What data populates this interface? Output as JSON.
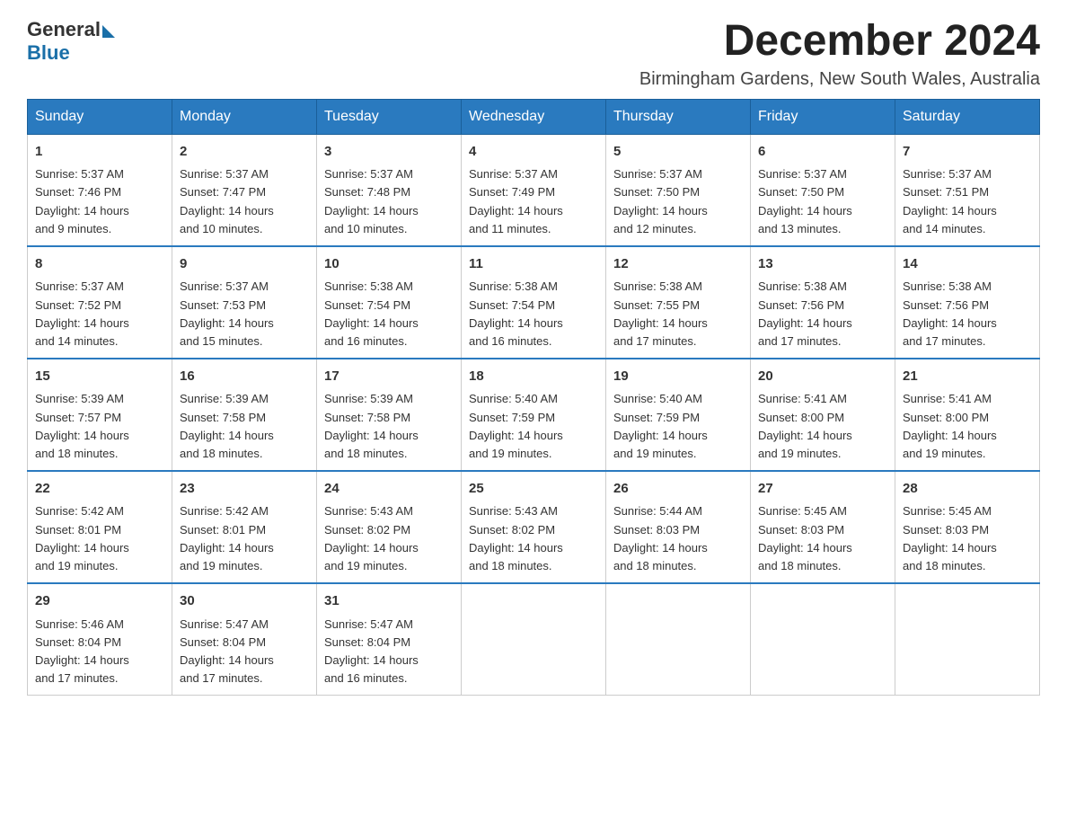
{
  "logo": {
    "general": "General",
    "blue": "Blue"
  },
  "title": {
    "month_year": "December 2024",
    "location": "Birmingham Gardens, New South Wales, Australia"
  },
  "days_header": [
    "Sunday",
    "Monday",
    "Tuesday",
    "Wednesday",
    "Thursday",
    "Friday",
    "Saturday"
  ],
  "weeks": [
    [
      {
        "day": "1",
        "sunrise": "5:37 AM",
        "sunset": "7:46 PM",
        "daylight": "14 hours and 9 minutes."
      },
      {
        "day": "2",
        "sunrise": "5:37 AM",
        "sunset": "7:47 PM",
        "daylight": "14 hours and 10 minutes."
      },
      {
        "day": "3",
        "sunrise": "5:37 AM",
        "sunset": "7:48 PM",
        "daylight": "14 hours and 10 minutes."
      },
      {
        "day": "4",
        "sunrise": "5:37 AM",
        "sunset": "7:49 PM",
        "daylight": "14 hours and 11 minutes."
      },
      {
        "day": "5",
        "sunrise": "5:37 AM",
        "sunset": "7:50 PM",
        "daylight": "14 hours and 12 minutes."
      },
      {
        "day": "6",
        "sunrise": "5:37 AM",
        "sunset": "7:50 PM",
        "daylight": "14 hours and 13 minutes."
      },
      {
        "day": "7",
        "sunrise": "5:37 AM",
        "sunset": "7:51 PM",
        "daylight": "14 hours and 14 minutes."
      }
    ],
    [
      {
        "day": "8",
        "sunrise": "5:37 AM",
        "sunset": "7:52 PM",
        "daylight": "14 hours and 14 minutes."
      },
      {
        "day": "9",
        "sunrise": "5:37 AM",
        "sunset": "7:53 PM",
        "daylight": "14 hours and 15 minutes."
      },
      {
        "day": "10",
        "sunrise": "5:38 AM",
        "sunset": "7:54 PM",
        "daylight": "14 hours and 16 minutes."
      },
      {
        "day": "11",
        "sunrise": "5:38 AM",
        "sunset": "7:54 PM",
        "daylight": "14 hours and 16 minutes."
      },
      {
        "day": "12",
        "sunrise": "5:38 AM",
        "sunset": "7:55 PM",
        "daylight": "14 hours and 17 minutes."
      },
      {
        "day": "13",
        "sunrise": "5:38 AM",
        "sunset": "7:56 PM",
        "daylight": "14 hours and 17 minutes."
      },
      {
        "day": "14",
        "sunrise": "5:38 AM",
        "sunset": "7:56 PM",
        "daylight": "14 hours and 17 minutes."
      }
    ],
    [
      {
        "day": "15",
        "sunrise": "5:39 AM",
        "sunset": "7:57 PM",
        "daylight": "14 hours and 18 minutes."
      },
      {
        "day": "16",
        "sunrise": "5:39 AM",
        "sunset": "7:58 PM",
        "daylight": "14 hours and 18 minutes."
      },
      {
        "day": "17",
        "sunrise": "5:39 AM",
        "sunset": "7:58 PM",
        "daylight": "14 hours and 18 minutes."
      },
      {
        "day": "18",
        "sunrise": "5:40 AM",
        "sunset": "7:59 PM",
        "daylight": "14 hours and 19 minutes."
      },
      {
        "day": "19",
        "sunrise": "5:40 AM",
        "sunset": "7:59 PM",
        "daylight": "14 hours and 19 minutes."
      },
      {
        "day": "20",
        "sunrise": "5:41 AM",
        "sunset": "8:00 PM",
        "daylight": "14 hours and 19 minutes."
      },
      {
        "day": "21",
        "sunrise": "5:41 AM",
        "sunset": "8:00 PM",
        "daylight": "14 hours and 19 minutes."
      }
    ],
    [
      {
        "day": "22",
        "sunrise": "5:42 AM",
        "sunset": "8:01 PM",
        "daylight": "14 hours and 19 minutes."
      },
      {
        "day": "23",
        "sunrise": "5:42 AM",
        "sunset": "8:01 PM",
        "daylight": "14 hours and 19 minutes."
      },
      {
        "day": "24",
        "sunrise": "5:43 AM",
        "sunset": "8:02 PM",
        "daylight": "14 hours and 19 minutes."
      },
      {
        "day": "25",
        "sunrise": "5:43 AM",
        "sunset": "8:02 PM",
        "daylight": "14 hours and 18 minutes."
      },
      {
        "day": "26",
        "sunrise": "5:44 AM",
        "sunset": "8:03 PM",
        "daylight": "14 hours and 18 minutes."
      },
      {
        "day": "27",
        "sunrise": "5:45 AM",
        "sunset": "8:03 PM",
        "daylight": "14 hours and 18 minutes."
      },
      {
        "day": "28",
        "sunrise": "5:45 AM",
        "sunset": "8:03 PM",
        "daylight": "14 hours and 18 minutes."
      }
    ],
    [
      {
        "day": "29",
        "sunrise": "5:46 AM",
        "sunset": "8:04 PM",
        "daylight": "14 hours and 17 minutes."
      },
      {
        "day": "30",
        "sunrise": "5:47 AM",
        "sunset": "8:04 PM",
        "daylight": "14 hours and 17 minutes."
      },
      {
        "day": "31",
        "sunrise": "5:47 AM",
        "sunset": "8:04 PM",
        "daylight": "14 hours and 16 minutes."
      },
      null,
      null,
      null,
      null
    ]
  ],
  "labels": {
    "sunrise": "Sunrise:",
    "sunset": "Sunset:",
    "daylight": "Daylight:"
  }
}
